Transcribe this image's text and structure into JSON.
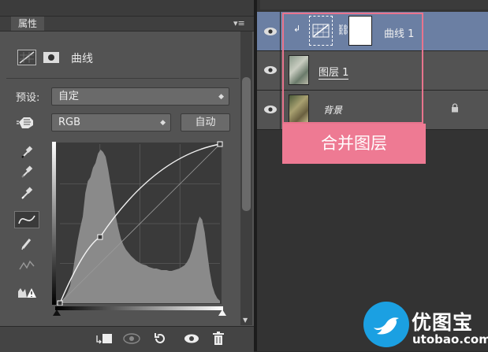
{
  "properties_panel": {
    "tab_label": "属性",
    "collapse_glyph": "◂◂",
    "close_glyph": "✕",
    "menu_glyph": "▾≡",
    "adjustment_title": "曲线",
    "preset_label": "预设:",
    "preset_value": "自定",
    "channel_value": "RGB",
    "auto_button": "自动",
    "select_arrow": "◆"
  },
  "layers": [
    {
      "name": "曲线 1",
      "selected": true,
      "type": "adjustment"
    },
    {
      "name": "图层 1",
      "selected": false,
      "type": "pixel"
    },
    {
      "name": "背景",
      "selected": false,
      "type": "background",
      "locked": true
    }
  ],
  "layer_glyphs": {
    "clip_arrow": "↲",
    "chain": "⛓"
  },
  "annotation": {
    "label": "合并图层",
    "color": "#ee7a93"
  },
  "watermark": {
    "name": "优图宝",
    "url": "utobao.com"
  },
  "colors": {
    "panel_bg": "#535353",
    "selected_layer": "#6b7fa3",
    "logo_blue": "#1ba0e2"
  },
  "chart_data": {
    "type": "curve",
    "curve_points": [
      [
        0,
        0
      ],
      [
        64,
        106
      ],
      [
        255,
        255
      ]
    ],
    "histogram_shape": "two peaks: large peak in dark tones, smaller peak in highlights",
    "xlim": [
      0,
      255
    ],
    "ylim": [
      0,
      255
    ],
    "grid": "4x4"
  }
}
